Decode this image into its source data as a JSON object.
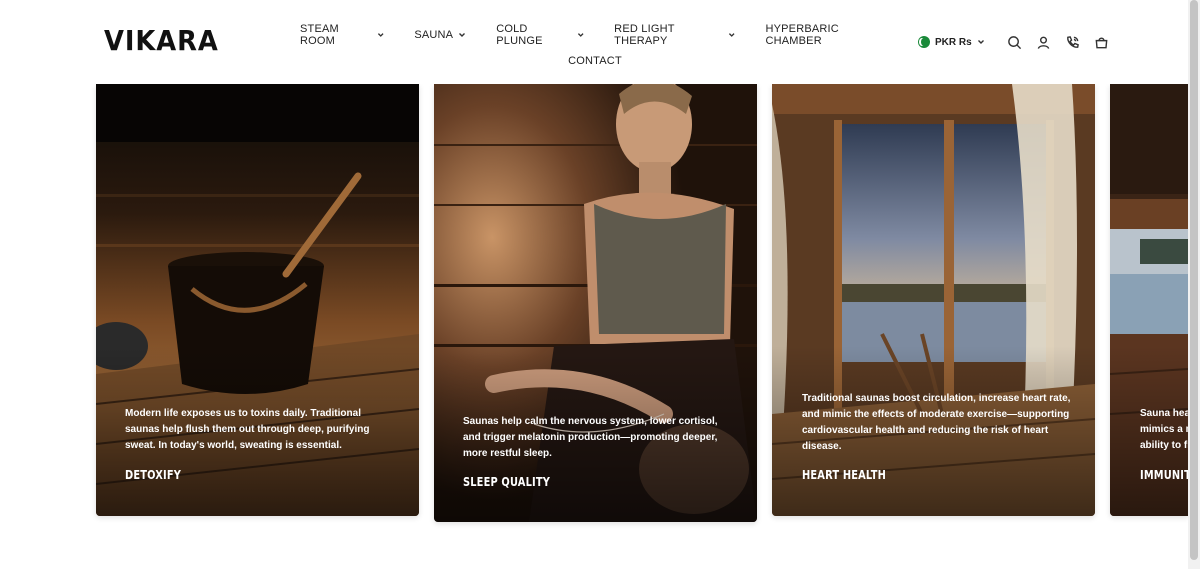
{
  "brand": {
    "logo": "VIKARA"
  },
  "nav": {
    "row1": [
      {
        "label": "STEAM ROOM",
        "dropdown": true
      },
      {
        "label": "SAUNA",
        "dropdown": true
      },
      {
        "label": "COLD PLUNGE",
        "dropdown": true
      },
      {
        "label": "RED LIGHT THERAPY",
        "dropdown": true
      },
      {
        "label": "HYPERBARIC CHAMBER",
        "dropdown": false
      }
    ],
    "row2": [
      {
        "label": "CONTACT",
        "dropdown": false
      }
    ]
  },
  "header_utils": {
    "currency_label": "PKR Rs",
    "icons": [
      "search-icon",
      "account-icon",
      "phone-icon",
      "cart-icon"
    ]
  },
  "cards": [
    {
      "title": "DETOXIFY",
      "body": "Modern life exposes us to toxins daily. Traditional saunas help flush them out through deep, purifying sweat. In today's world, sweating is essential."
    },
    {
      "title": "SLEEP QUALITY",
      "body": "Saunas help calm the nervous system, lower cortisol, and trigger melatonin production—promoting deeper, more restful sleep."
    },
    {
      "title": "HEART HEALTH",
      "body": "Traditional saunas boost circulation, increase heart rate, and mimic the effects of moderate exercise—supporting cardiovascular health and reducing the risk of heart disease."
    },
    {
      "title": "IMMUNITY B",
      "body_lines": [
        "Sauna heat",
        "mimics a m",
        "ability to fig"
      ]
    }
  ],
  "colors": {
    "accent": "#111111",
    "flag_green": "#1a8a3a"
  }
}
